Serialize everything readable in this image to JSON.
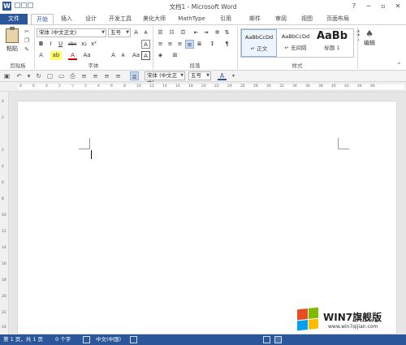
{
  "window": {
    "title": "文档1 - Microsoft Word",
    "app_icon": "W",
    "help": "?",
    "minimize": "─",
    "restore": "▫",
    "close": "✕"
  },
  "tabs": [
    {
      "label": "文件"
    },
    {
      "label": "开始"
    },
    {
      "label": "插入"
    },
    {
      "label": "设计"
    },
    {
      "label": "开发工具"
    },
    {
      "label": "美化大师"
    },
    {
      "label": "MathType"
    },
    {
      "label": "引用"
    },
    {
      "label": "邮件"
    },
    {
      "label": "审阅"
    },
    {
      "label": "视图"
    },
    {
      "label": "页面布局"
    }
  ],
  "ribbon": {
    "clipboard": {
      "paste_label": "粘贴",
      "group_label": "剪贴板"
    },
    "font": {
      "font_name": "宋体 (中文正文)",
      "font_size": "五号",
      "grow": "A",
      "shrink": "A",
      "clear": "A",
      "bold": "B",
      "italic": "I",
      "underline": "U",
      "strike": "abc",
      "subscript": "x₂",
      "superscript": "x²",
      "color_a": "A",
      "highlight": "ab",
      "font_color": "A",
      "aa": "Aa",
      "char_border": "A",
      "group_label": "字体"
    },
    "paragraph": {
      "group_label": "段落"
    },
    "styles": {
      "items": [
        {
          "sample": "AaBbCcDd",
          "name": "↵ 正文"
        },
        {
          "sample": "AaBbCcDd",
          "name": "↵ 无间隔"
        },
        {
          "sample": "AaBb",
          "name": "标题 1"
        }
      ],
      "group_label": "样式"
    },
    "editing": {
      "label": "编辑",
      "icon": "♠"
    }
  },
  "qat": {
    "font_name": "宋体 (中文正文)",
    "font_size": "五号",
    "font_color_label": "A"
  },
  "ruler": {
    "ticks": [
      "8",
      "6",
      "4",
      "2",
      "",
      "2",
      "4",
      "6",
      "8",
      "10",
      "12",
      "14",
      "16",
      "18",
      "20",
      "22",
      "24",
      "26",
      "28",
      "30",
      "32",
      "34",
      "36",
      "38",
      "40",
      "42",
      "44",
      "46"
    ],
    "vticks": [
      "4",
      "2",
      "",
      "2",
      "4",
      "6",
      "8",
      "10",
      "12",
      "14",
      "16",
      "18",
      "20",
      "22",
      "24"
    ]
  },
  "status": {
    "page": "第 1 页，共 1 页",
    "words": "0 个字",
    "lang": "中文(中国)"
  },
  "watermark": {
    "text": "WIN7旗舰版",
    "url": "www.win7qijian.com"
  },
  "colors": {
    "accent": "#2b579a",
    "ribbon_bg": "#ffffff",
    "selected_bg": "#c5d9ef"
  }
}
